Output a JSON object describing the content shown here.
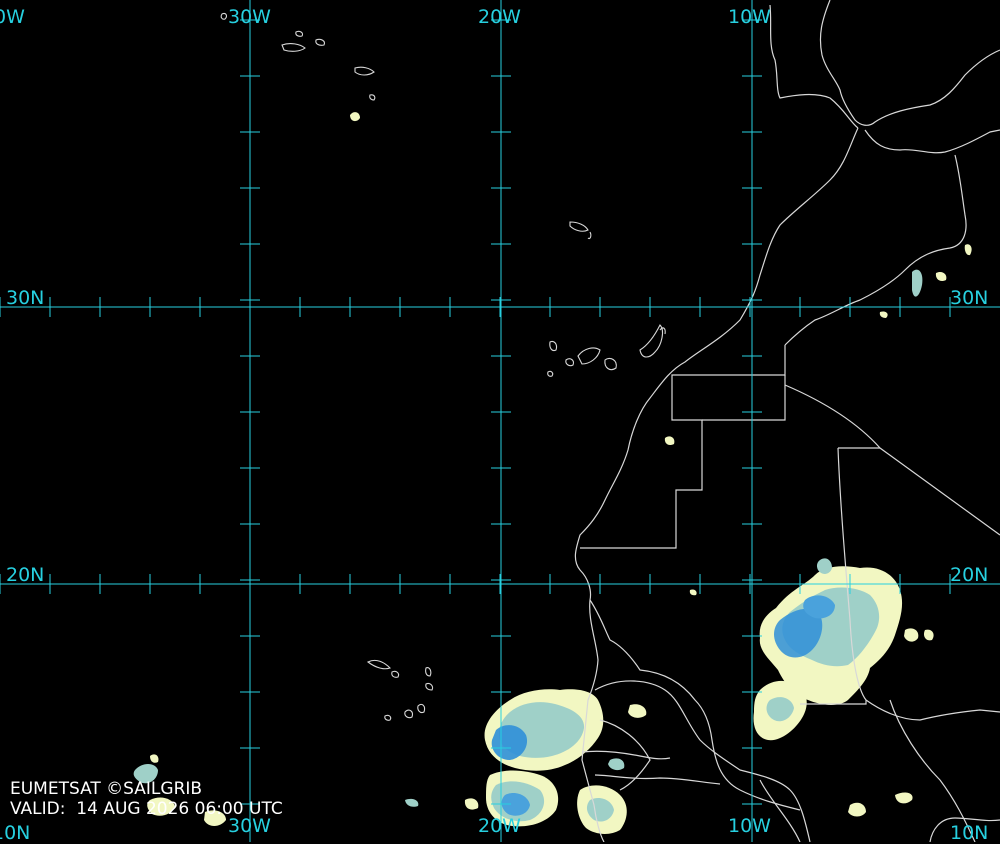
{
  "map": {
    "colors": {
      "background": "#000000",
      "graticule": "#27d0e0",
      "coastline": "#d8d8d8",
      "cloud_light": "#f2f7c2",
      "cloud_mid": "#9fd0c8",
      "cloud_dense": "#2f8fd8"
    },
    "longitude_labels_top": [
      "0W",
      "30W",
      "20W",
      "10W"
    ],
    "longitude_labels_bottom": [
      "10N",
      "30W",
      "20W",
      "10W",
      "10N"
    ],
    "latitude_labels_left": [
      "30N",
      "20N"
    ],
    "latitude_labels_right": [
      "30N",
      "20N"
    ]
  },
  "credit": {
    "source": "EUMETSAT ©SAILGRIB",
    "valid": "VALID:  14 AUG 2026 06:00 UTC"
  }
}
